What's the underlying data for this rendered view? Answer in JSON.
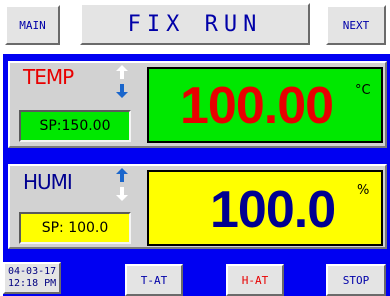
{
  "header": {
    "title": "FIX RUN",
    "main_label": "MAIN",
    "next_label": "NEXT"
  },
  "temp": {
    "label": "TEMP",
    "setpoint": "SP:150.00",
    "value": "100.00",
    "unit": "°C",
    "value_color": "#e80000",
    "value_bg": "#00e800"
  },
  "humi": {
    "label": "HUMI",
    "setpoint": "SP: 100.0",
    "value": "100.0",
    "unit": "%",
    "value_color": "#000090",
    "value_bg": "#ffff00"
  },
  "footer": {
    "date": "04-03-17",
    "time": "12:18 PM",
    "t_at_label": "T-AT",
    "h_at_label": "H-AT",
    "stop_label": "STOP"
  },
  "colors": {
    "screen_bg": "#0000f2",
    "button_face": "#e4e4e4",
    "button_text": "#0000a8",
    "h_at_text": "#e80000",
    "arrow_up": "#ffffff",
    "arrow_active": "#1a66cc"
  },
  "icons": [
    "arrow-up-icon",
    "arrow-down-icon"
  ]
}
